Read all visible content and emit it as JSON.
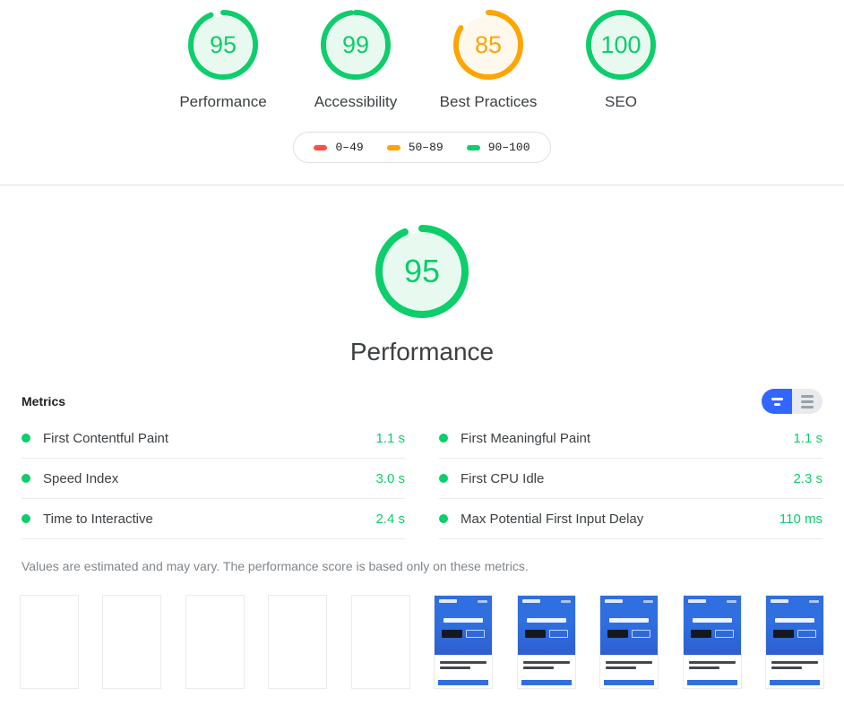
{
  "colors": {
    "pass": "#0cce6b",
    "average": "#ffa400",
    "fail": "#ff4e42",
    "pass_fill": "#e8faf0",
    "average_fill": "#fff8ed",
    "toggle_active": "#3366ff",
    "toggle_inactive": "#e8eaed"
  },
  "scores": [
    {
      "value": "95",
      "label": "Performance",
      "rating": "pass",
      "pct": 95
    },
    {
      "value": "99",
      "label": "Accessibility",
      "rating": "pass",
      "pct": 99
    },
    {
      "value": "85",
      "label": "Best Practices",
      "rating": "average",
      "pct": 85
    },
    {
      "value": "100",
      "label": "SEO",
      "rating": "pass",
      "pct": 100
    }
  ],
  "legend": {
    "items": [
      {
        "range": "0–49",
        "rating": "fail"
      },
      {
        "range": "50–89",
        "rating": "average"
      },
      {
        "range": "90–100",
        "rating": "pass"
      }
    ]
  },
  "category": {
    "score": "95",
    "title": "Performance",
    "rating": "pass",
    "pct": 95
  },
  "metrics": {
    "title": "Metrics",
    "toggle": {
      "simple_label": "simple-view",
      "expanded_label": "expanded-view",
      "active": "simple-view"
    },
    "columns": [
      [
        {
          "name": "First Contentful Paint",
          "value": "1.1 s",
          "rating": "pass"
        },
        {
          "name": "Speed Index",
          "value": "3.0 s",
          "rating": "pass"
        },
        {
          "name": "Time to Interactive",
          "value": "2.4 s",
          "rating": "pass"
        }
      ],
      [
        {
          "name": "First Meaningful Paint",
          "value": "1.1 s",
          "rating": "pass"
        },
        {
          "name": "First CPU Idle",
          "value": "2.3 s",
          "rating": "pass"
        },
        {
          "name": "Max Potential First Input Delay",
          "value": "110 ms",
          "rating": "pass"
        }
      ]
    ],
    "disclaimer_prefix": "Values are estimated and may vary. The performance score is ",
    "disclaimer_link": "based only on these metrics."
  },
  "filmstrip": {
    "frames": [
      {
        "state": "blank"
      },
      {
        "state": "blank"
      },
      {
        "state": "blank"
      },
      {
        "state": "blank"
      },
      {
        "state": "blank"
      },
      {
        "state": "loaded"
      },
      {
        "state": "loaded"
      },
      {
        "state": "loaded"
      },
      {
        "state": "loaded"
      },
      {
        "state": "loaded"
      }
    ]
  }
}
